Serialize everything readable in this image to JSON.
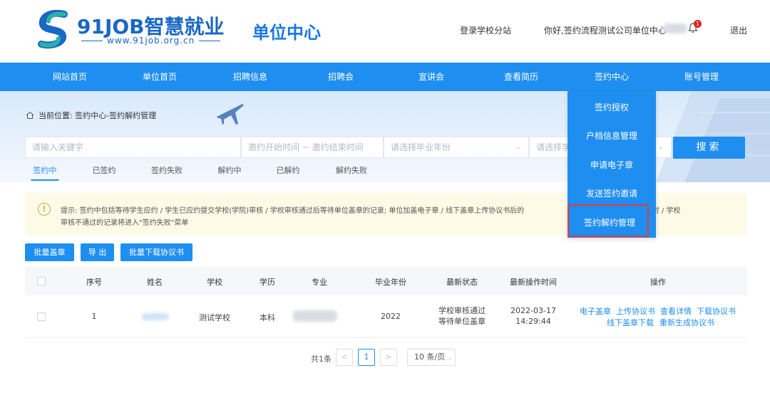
{
  "header": {
    "logo_title": "91JOB智慧就业",
    "logo_url": "www.91job.org.cn",
    "center_title": "单位中心",
    "login_branch": "登录学校分站",
    "greeting": "你好,签约流程测试公司单位中心",
    "notification_count": "1",
    "logout": "退出"
  },
  "nav": {
    "items": [
      "网站首页",
      "单位首页",
      "招聘信息",
      "招聘会",
      "宣讲会",
      "查看简历",
      "签约中心",
      "账号管理"
    ]
  },
  "breadcrumb": {
    "text": "当前位置: 签约中心-签约解约管理"
  },
  "search": {
    "keyword_placeholder": "请输入关键字",
    "date_range_placeholder": "邀约开始时间 ~ 邀约结束时间",
    "grad_year_placeholder": "请选择毕业年份",
    "fourth_placeholder": "请选择学",
    "button": "搜索"
  },
  "tabs": [
    "签约中",
    "已签约",
    "签约失败",
    "解约中",
    "已解约",
    "解约失败"
  ],
  "notice": {
    "text": "提示: 签约中包括等待学生应约 / 学生已应约提交学校(学院)审核 / 学校审核通过后等待单位盖章的记录; 单位加盖电子章 / 线下盖章上传协议书后的",
    "text_right": "学生拒绝 / 超时 / 学校",
    "text_line2": "审核不通过的记录将进入\"签约失败\"菜单"
  },
  "actions": {
    "batch_stamp": "批量盖章",
    "export": "导 出",
    "batch_download": "批量下载协议书"
  },
  "table": {
    "headers": [
      "序号",
      "姓名",
      "学校",
      "学历",
      "专业",
      "毕业年份",
      "最新状态",
      "最新操作时间",
      "操作"
    ],
    "rows": [
      {
        "index": "1",
        "school": "测试学校",
        "degree": "本科",
        "grad_year": "2022",
        "status_line1": "学校审核通过",
        "status_line2": "等待单位盖章",
        "time_line1": "2022-03-17",
        "time_line2": "14:29:44",
        "ops": [
          "电子盖章",
          "上传协议书",
          "查看详情",
          "下载协议书",
          "线下盖章下载",
          "重新生成协议书"
        ]
      }
    ]
  },
  "pagination": {
    "total": "共1条",
    "prev": "<",
    "current": "1",
    "next": ">",
    "page_size": "10 条/页"
  },
  "dropdown": {
    "items": [
      "签约授权",
      "户档信息管理",
      "申请电子章",
      "发送签约邀请",
      "签约解约管理"
    ]
  },
  "colors": {
    "primary": "#1f8ef1",
    "brand": "#1a67c4",
    "highlight": "#e53935",
    "notice_bg": "#fdfbe7"
  }
}
